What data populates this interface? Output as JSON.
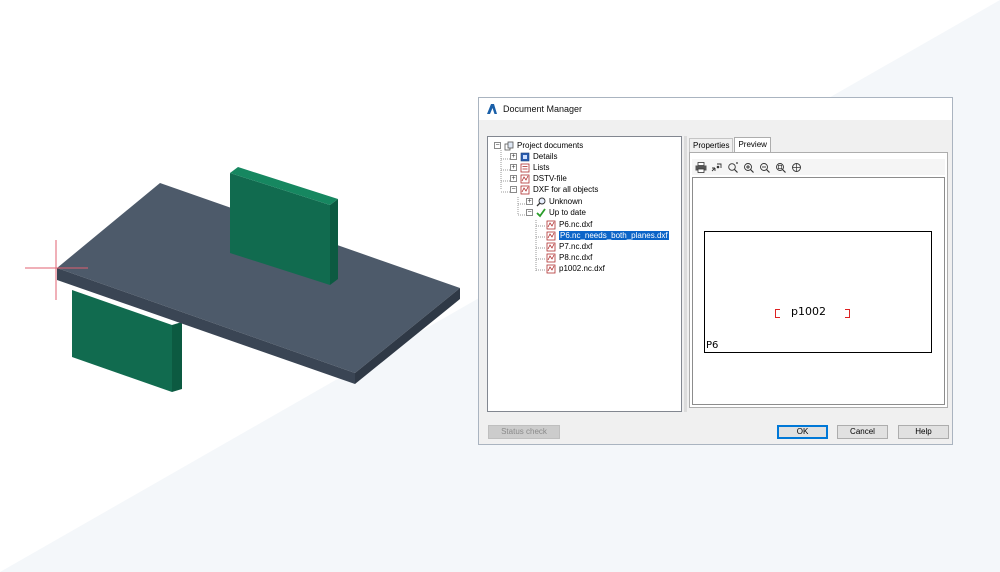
{
  "dialog": {
    "title": "Document Manager",
    "tree": [
      {
        "label": "Project documents",
        "icon": "project-documents-icon",
        "expander": "−"
      },
      {
        "label": "Details",
        "icon": "details-icon",
        "expander": "+"
      },
      {
        "label": "Lists",
        "icon": "lists-icon",
        "expander": "+"
      },
      {
        "label": "DSTV-file",
        "icon": "dstv-file-icon",
        "expander": "+"
      },
      {
        "label": "DXF for all objects",
        "icon": "dxf-icon",
        "expander": "−"
      },
      {
        "label": "Unknown",
        "icon": "magnifier-icon",
        "expander": "+"
      },
      {
        "label": "Up to date",
        "icon": "checkmark-icon",
        "expander": "−"
      },
      {
        "label": "P6.nc.dxf",
        "icon": "dxf-file-icon"
      },
      {
        "label": "P6.nc_needs_both_planes.dxf",
        "icon": "dxf-file-icon",
        "selected": true
      },
      {
        "label": "P7.nc.dxf",
        "icon": "dxf-file-icon"
      },
      {
        "label": "P8.nc.dxf",
        "icon": "dxf-file-icon"
      },
      {
        "label": "p1002.nc.dxf",
        "icon": "dxf-file-icon"
      }
    ],
    "tabs": [
      {
        "label": "Properties",
        "active": false
      },
      {
        "label": "Preview",
        "active": true
      }
    ],
    "toolbar_icons": [
      "print-icon",
      "pan-icon",
      "zoom-realtime-icon",
      "zoom-in-icon",
      "zoom-out-icon",
      "zoom-window-icon",
      "zoom-extents-icon"
    ],
    "preview": {
      "part_label": "p1002",
      "corner_label": "P6"
    },
    "buttons": {
      "status_check": "Status check",
      "ok": "OK",
      "cancel": "Cancel",
      "help": "Help"
    }
  },
  "colors": {
    "plate_top": "#4d5a6a",
    "plate_front": "#3a4554",
    "plate_side": "#2f3946",
    "stiffener": "#116b4f",
    "selection": "#0b64c8",
    "crosshair": "#e06070"
  }
}
